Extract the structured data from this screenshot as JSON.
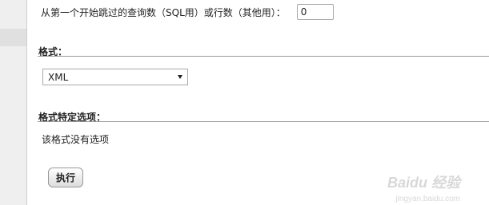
{
  "skip": {
    "label": "从第一个开始跳过的查询数（SQL用）或行数（其他用）：",
    "value": "0"
  },
  "format_section": {
    "title": "格式：",
    "selected": "XML"
  },
  "format_options_section": {
    "title": "格式特定选项：",
    "message": "该格式没有选项"
  },
  "actions": {
    "execute_label": "执行"
  },
  "watermark": {
    "brand": "Baidu 经验",
    "url": "jingyan.baidu.com"
  }
}
